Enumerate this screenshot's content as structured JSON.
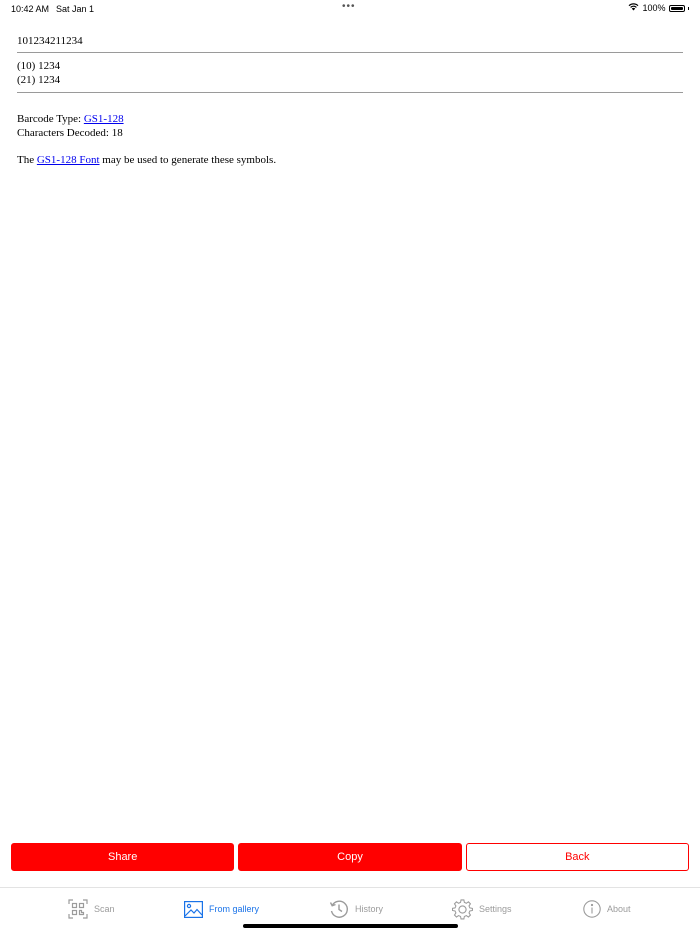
{
  "status_bar": {
    "time": "10:42 AM",
    "date": "Sat Jan 1",
    "dots": "•••",
    "battery": "100%",
    "wifi_icon": "wifi-icon",
    "battery_icon": "battery-icon"
  },
  "result": {
    "raw_data": "101234211234",
    "parsed_lines": [
      "(10) 1234",
      "(21) 1234"
    ],
    "barcode_type_label": "Barcode Type: ",
    "barcode_type_value": "GS1-128",
    "characters_decoded_label": "Characters Decoded: ",
    "characters_decoded_value": "18",
    "note_prefix": "The ",
    "note_link": "GS1-128 Font",
    "note_suffix": " may be used to generate these symbols."
  },
  "actions": {
    "share": "Share",
    "copy": "Copy",
    "back": "Back"
  },
  "tabs": [
    {
      "label": "Scan",
      "icon": "qr-scan-icon",
      "active": false
    },
    {
      "label": "From gallery",
      "icon": "image-gallery-icon",
      "active": true
    },
    {
      "label": "History",
      "icon": "history-clock-icon",
      "active": false
    },
    {
      "label": "Settings",
      "icon": "gear-icon",
      "active": false
    },
    {
      "label": "About",
      "icon": "info-icon",
      "active": false
    }
  ],
  "colors": {
    "accent_red": "#ff0000",
    "tab_active": "#1a73e8",
    "tab_inactive": "#9b9b9b",
    "link": "#0000ee"
  }
}
